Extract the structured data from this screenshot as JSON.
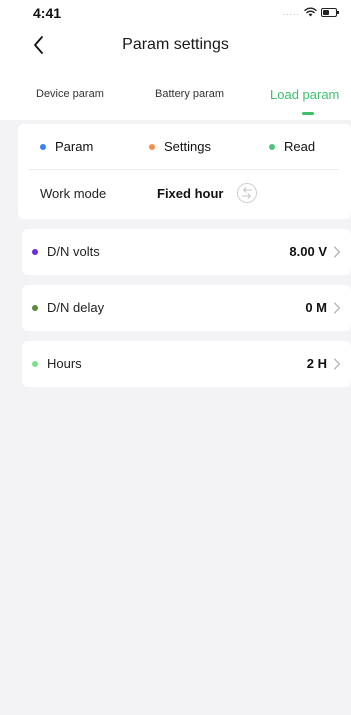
{
  "status_bar": {
    "time": "4:41",
    "signal": "....."
  },
  "header": {
    "title": "Param settings",
    "back_icon": "chevron-left-icon"
  },
  "tabs": [
    {
      "label": "Device param",
      "active": false
    },
    {
      "label": "Battery param",
      "active": false
    },
    {
      "label": "Load param",
      "active": true
    }
  ],
  "legend": [
    {
      "label": "Param",
      "color": "#3b82f0"
    },
    {
      "label": "Settings",
      "color": "#f5904a"
    },
    {
      "label": "Read",
      "color": "#4cc77a"
    }
  ],
  "work_mode": {
    "label": "Work mode",
    "value": "Fixed hour",
    "icon": "switch-arrow-icon"
  },
  "params": [
    {
      "label": "D/N volts",
      "value": "8.00 V",
      "color": "#6a2fd6"
    },
    {
      "label": "D/N delay",
      "value": "0 M",
      "color": "#5b8a3a"
    },
    {
      "label": "Hours",
      "value": "2 H",
      "color": "#7ee08a"
    }
  ],
  "colors": {
    "accent": "#3fbf6b",
    "background": "#f3f3f5"
  }
}
